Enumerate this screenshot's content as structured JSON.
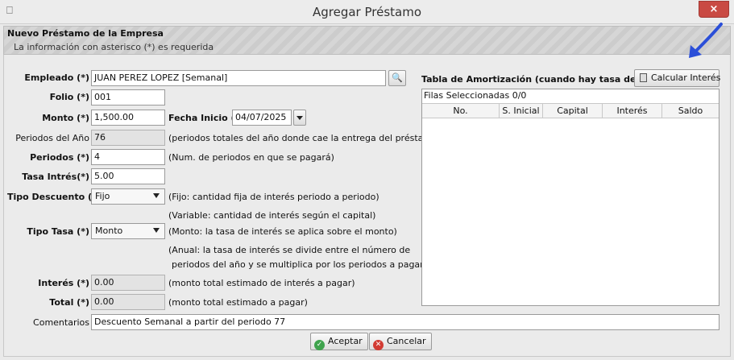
{
  "window": {
    "title": "Agregar Préstamo",
    "close_label": "×"
  },
  "header": {
    "title": "Nuevo Préstamo de la Empresa",
    "subtitle": "La información con asterisco (*) es requerida"
  },
  "form": {
    "empleado": {
      "label": "Empleado (*)",
      "value": "JUAN PEREZ LOPEZ [Semanal]"
    },
    "folio": {
      "label": "Folio (*)",
      "value": "001"
    },
    "monto": {
      "label": "Monto (*)",
      "value": "1,500.00"
    },
    "fecha_inicio": {
      "label": "Fecha Inicio (*)",
      "value": "04/07/2025"
    },
    "periodos_anio": {
      "label": "Periodos del Año",
      "value": "76",
      "hint": "(periodos totales del año donde cae la entrega del préstamo)"
    },
    "periodos": {
      "label": "Periodos (*)",
      "value": "4",
      "hint": "(Num. de periodos en que se pagará)"
    },
    "tasa": {
      "label": "Tasa Intrés(*)",
      "value": "5.00"
    },
    "tipo_descuento": {
      "label": "Tipo Descuento (*)",
      "value": "Fijo",
      "hint1": "(Fijo: cantidad fija de interés periodo a periodo)",
      "hint2": "(Variable: cantidad de interés según el capital)"
    },
    "tipo_tasa": {
      "label": "Tipo Tasa (*)",
      "value": "Monto",
      "hint1": "(Monto: la tasa de interés se aplica sobre el monto)",
      "hint2": "(Anual: la tasa de interés se divide entre el número de",
      "hint3": "periodos del año y se multiplica por los periodos a pagar)"
    },
    "interes": {
      "label": "Interés (*)",
      "value": "0.00",
      "hint": "(monto total estimado de interés a pagar)"
    },
    "total": {
      "label": "Total (*)",
      "value": "0.00",
      "hint": "(monto total estimado a pagar)"
    },
    "comentarios": {
      "label": "Comentarios",
      "value": "Descuento Semanal a partir del periodo 77"
    }
  },
  "amortizacion": {
    "title": "Tabla de Amortización (cuando hay tasa de interés)",
    "calc_button": "Calcular Interés",
    "selected": "Filas Seleccionadas 0/0",
    "columns": [
      "No.",
      "S. Inicial",
      "Capital",
      "Interés",
      "Saldo"
    ]
  },
  "actions": {
    "accept": "Aceptar",
    "cancel": "Cancelar"
  },
  "colors": {
    "accept": "#3fa34d",
    "cancel": "#d23b33",
    "arrow": "#2b4fd8"
  }
}
